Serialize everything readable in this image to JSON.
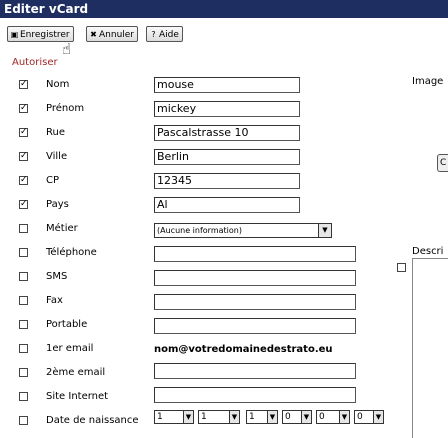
{
  "window": {
    "title": "Editer vCard"
  },
  "toolbar": {
    "save": {
      "label": "Enregistrer",
      "icon": "floppy-disk-icon"
    },
    "cancel": {
      "label": "Annuler",
      "icon": "close-icon"
    },
    "help": {
      "label": "Aide",
      "icon": "question-icon"
    }
  },
  "autoriser_label": "Autoriser",
  "fields": [
    {
      "label": "Nom",
      "checked": true,
      "value": "mouse"
    },
    {
      "label": "Prénom",
      "checked": true,
      "value": "mickey"
    },
    {
      "label": "Rue",
      "checked": true,
      "value": "Pascalstrasse 10"
    },
    {
      "label": "Ville",
      "checked": true,
      "value": "Berlin"
    },
    {
      "label": "CP",
      "checked": true,
      "value": "12345"
    },
    {
      "label": "Pays",
      "checked": true,
      "value": "Al"
    },
    {
      "label": "Métier",
      "checked": false,
      "value": "(Aucune information)"
    },
    {
      "label": "Téléphone",
      "checked": false,
      "value": ""
    },
    {
      "label": "SMS",
      "checked": false,
      "value": ""
    },
    {
      "label": "Fax",
      "checked": false,
      "value": ""
    },
    {
      "label": "Portable",
      "checked": false,
      "value": ""
    },
    {
      "label": "1er email",
      "checked": false,
      "value": "nom@votredomainedestrato.eu"
    },
    {
      "label": "2ème email",
      "checked": false,
      "value": ""
    },
    {
      "label": "Site Internet",
      "checked": false,
      "value": ""
    },
    {
      "label": "Date de naissance",
      "checked": false,
      "value": ""
    }
  ],
  "birthdate_selects": [
    "1",
    "1",
    "1",
    "0",
    "0",
    "0"
  ],
  "right": {
    "image_label": "Image",
    "description_label": "Descri",
    "button_label": "C"
  },
  "colors": {
    "titlebar": "#1f2e60",
    "autoriser": "#a02828"
  }
}
